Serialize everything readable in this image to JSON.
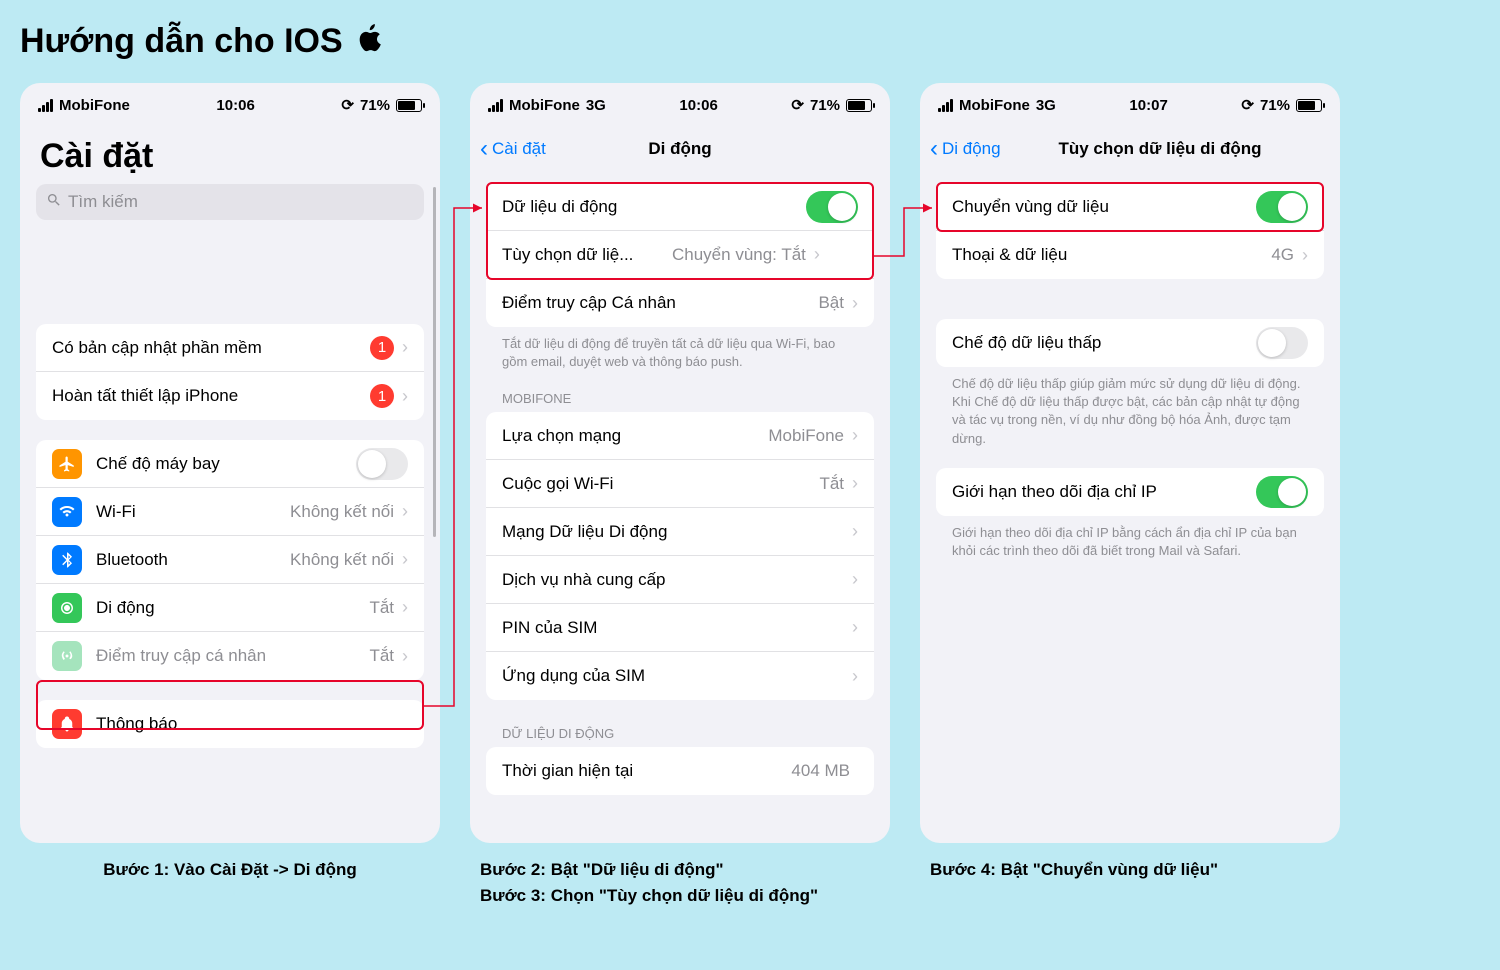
{
  "guide_title": "Hướng dẫn cho IOS",
  "phone1": {
    "carrier": "MobiFone",
    "time": "10:06",
    "battery": "71%",
    "title": "Cài đặt",
    "search_placeholder": "Tìm kiếm",
    "group1": [
      {
        "label": "Có bản cập nhật phần mềm",
        "badge": "1"
      },
      {
        "label": "Hoàn tất thiết lập iPhone",
        "badge": "1"
      }
    ],
    "group2": [
      {
        "label": "Chế độ máy bay",
        "color": "#ff9500",
        "type": "toggle",
        "on": false,
        "icon": "airplane"
      },
      {
        "label": "Wi-Fi",
        "color": "#007aff",
        "detail": "Không kết nối",
        "icon": "wifi"
      },
      {
        "label": "Bluetooth",
        "color": "#007aff",
        "detail": "Không kết nối",
        "icon": "bluetooth"
      },
      {
        "label": "Di động",
        "color": "#34c759",
        "detail": "Tắt",
        "icon": "cellular",
        "highlight": true
      },
      {
        "label": "Điểm truy cập cá nhân",
        "color": "#a5e4bd",
        "detail": "Tắt",
        "icon": "hotspot",
        "dim": true
      }
    ],
    "group3": [
      {
        "label": "Thông báo",
        "color": "#ff3b30",
        "icon": "notif"
      }
    ]
  },
  "phone2": {
    "carrier": "MobiFone",
    "net": "3G",
    "time": "10:06",
    "battery": "71%",
    "back": "Cài đặt",
    "title": "Di động",
    "rows1": [
      {
        "label": "Dữ liệu di động",
        "type": "toggle",
        "on": true
      },
      {
        "label": "Tùy chọn dữ liệ...",
        "detail": "Chuyển vùng: Tắt"
      },
      {
        "label": "Điểm truy cập Cá nhân",
        "detail": "Bật"
      }
    ],
    "note1": "Tắt dữ liệu di động để truyền tất cả dữ liệu qua Wi-Fi, bao gồm email, duyệt web và thông báo push.",
    "header2": "MOBIFONE",
    "rows2": [
      {
        "label": "Lựa chọn mạng",
        "detail": "MobiFone"
      },
      {
        "label": "Cuộc gọi Wi-Fi",
        "detail": "Tắt"
      },
      {
        "label": "Mạng Dữ liệu Di động"
      },
      {
        "label": "Dịch vụ nhà cung cấp"
      },
      {
        "label": "PIN của SIM"
      },
      {
        "label": "Ứng dụng của SIM"
      }
    ],
    "header3": "DỮ LIỆU DI ĐỘNG",
    "rows3": [
      {
        "label": "Thời gian hiện tại",
        "detail": "404 MB"
      }
    ]
  },
  "phone3": {
    "carrier": "MobiFone",
    "net": "3G",
    "time": "10:07",
    "battery": "71%",
    "back": "Di động",
    "title": "Tùy chọn dữ liệu di động",
    "rows1": [
      {
        "label": "Chuyển vùng dữ liệu",
        "type": "toggle",
        "on": true,
        "highlight": true
      },
      {
        "label": "Thoại & dữ liệu",
        "detail": "4G"
      }
    ],
    "rows2": [
      {
        "label": "Chế độ dữ liệu thấp",
        "type": "toggle",
        "on": false
      }
    ],
    "note2": "Chế độ dữ liệu thấp giúp giảm mức sử dụng dữ liệu di động. Khi Chế độ dữ liệu thấp được bật, các bản cập nhật tự động và tác vụ trong nền, ví dụ như đồng bộ hóa Ảnh, được tạm dừng.",
    "rows3": [
      {
        "label": "Giới hạn theo dõi địa chỉ IP",
        "type": "toggle",
        "on": true
      }
    ],
    "note3": "Giới hạn theo dõi địa chỉ IP bằng cách ẩn địa chỉ IP của bạn khỏi các trình theo dõi đã biết trong Mail và Safari."
  },
  "captions": {
    "c1": "Bước 1: Vào Cài Đặt -> Di động",
    "c2a": "Bước 2: Bật \"Dữ liệu di động\"",
    "c2b": "Bước 3: Chọn \"Tùy chọn dữ liệu di động\"",
    "c3": "Bước 4: Bật \"Chuyển vùng dữ liệu\""
  }
}
